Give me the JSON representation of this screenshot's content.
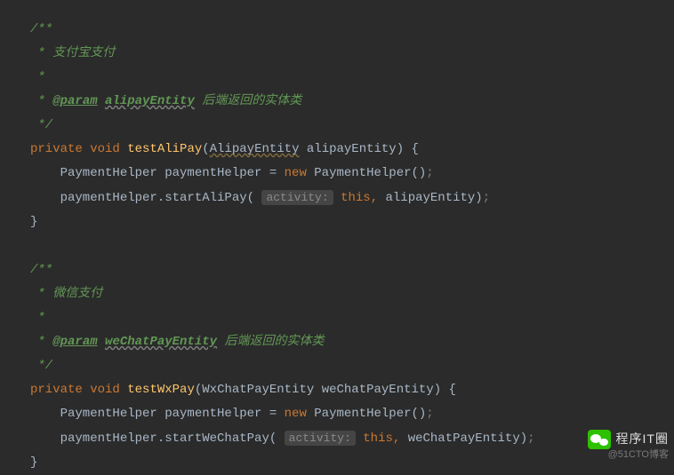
{
  "block1": {
    "c0": "/**",
    "c1": " * 支付宝支付",
    "c2": " *",
    "c3_prefix": " * ",
    "c3_tag": "@param",
    "c3_space": " ",
    "c3_name": "alipayEntity",
    "c3_desc": " 后端返回的实体类",
    "c4": " */",
    "sig_kw1": "private",
    "sig_kw2": "void",
    "sig_method": "testAliPay",
    "sig_open": "(",
    "sig_ptype": "AlipayEntity",
    "sig_pname": " alipayEntity",
    "sig_close": ") {",
    "l1_a": "    PaymentHelper paymentHelper = ",
    "l1_new": "new",
    "l1_b": " PaymentHelper()",
    "l1_semi": ";",
    "l2_a": "    paymentHelper.startAliPay( ",
    "l2_hint": "activity:",
    "l2_space": " ",
    "l2_this": "this",
    "l2_comma": ",",
    "l2_b": " alipayEntity)",
    "l2_semi": ";",
    "close": "}"
  },
  "block2": {
    "c0": "/**",
    "c1": " * 微信支付",
    "c2": " *",
    "c3_prefix": " * ",
    "c3_tag": "@param",
    "c3_space": " ",
    "c3_name": "weChatPayEntity",
    "c3_desc": " 后端返回的实体类",
    "c4": " */",
    "sig_kw1": "private",
    "sig_kw2": "void",
    "sig_method": "testWxPay",
    "sig_open": "(",
    "sig_ptype": "WxChatPayEntity",
    "sig_pname": " weChatPayEntity",
    "sig_close": ") {",
    "l1_a": "    PaymentHelper paymentHelper = ",
    "l1_new": "new",
    "l1_b": " PaymentHelper()",
    "l1_semi": ";",
    "l2_a": "    paymentHelper.startWeChatPay( ",
    "l2_hint": "activity:",
    "l2_space": " ",
    "l2_this": "this",
    "l2_comma": ",",
    "l2_b": " weChatPayEntity)",
    "l2_semi": ";",
    "close": "}"
  },
  "watermark": {
    "wechat": "程序IT圈",
    "blog": "@51CTO博客"
  }
}
